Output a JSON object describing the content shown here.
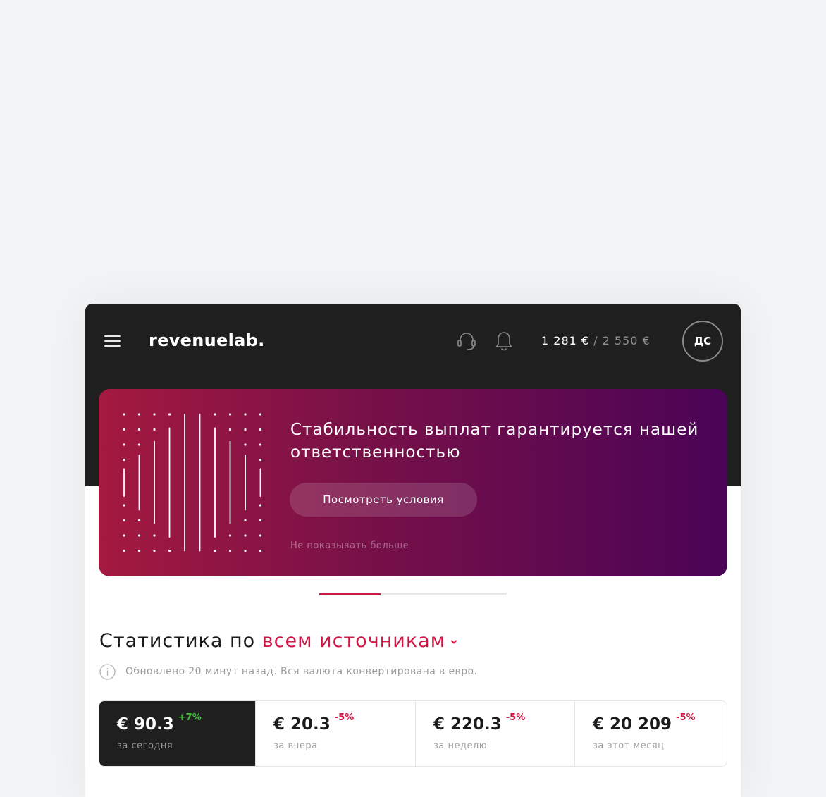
{
  "header": {
    "logo": "revenuelab.",
    "balance_current": "1 281 €",
    "balance_separator": " / ",
    "balance_limit": "2 550 €",
    "avatar_initials": "ДС",
    "icons": [
      "menu-icon",
      "support-headset-icon",
      "bell-icon"
    ]
  },
  "banner": {
    "title": "Стабильность выплат гарантируется нашей ответственностью",
    "cta_label": "Посмотреть условия",
    "dismiss_label": "Не показывать больше",
    "colors": {
      "gradient_start": "#a4193f",
      "gradient_end": "#4a0456"
    },
    "carousel": {
      "active_index": 1,
      "total": 3
    }
  },
  "stats": {
    "title_prefix": "Статистика по",
    "source_label": "всем источникам",
    "updated_note": "Обновлено 20 минут назад. Вся валюта конвертирована в евро.",
    "items": [
      {
        "value": "€ 90.3",
        "change": "+7%",
        "trend": "up",
        "label": "за сегодня",
        "active": true
      },
      {
        "value": "€ 20.3",
        "change": "-5%",
        "trend": "down",
        "label": "за вчера",
        "active": false
      },
      {
        "value": "€ 220.3",
        "change": "-5%",
        "trend": "down",
        "label": "за неделю",
        "active": false
      },
      {
        "value": "€ 20 209",
        "change": "-5%",
        "trend": "down",
        "label": "за этот месяц",
        "active": false
      }
    ]
  },
  "colors": {
    "accent": "#d01745",
    "positive": "#3fbf39",
    "dark": "#1f1f1f",
    "page_bg": "#f2f3f5"
  }
}
